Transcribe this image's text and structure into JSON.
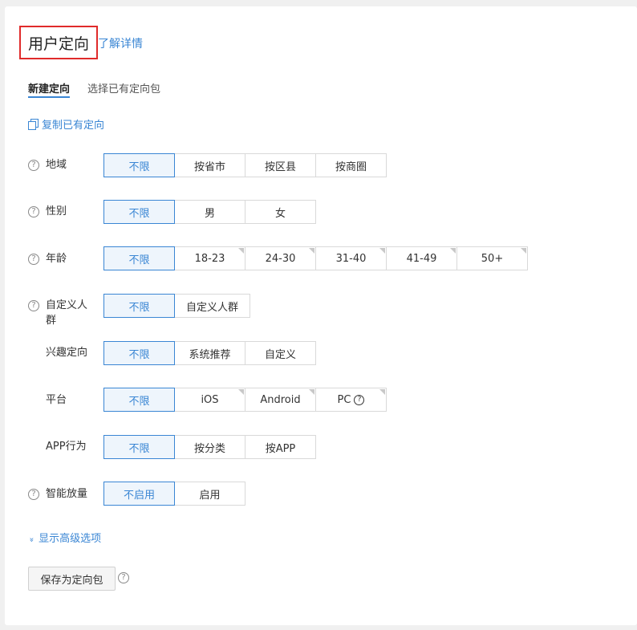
{
  "header": {
    "title": "用户定向",
    "detail_link": "了解详情"
  },
  "tabs": [
    {
      "label": "新建定向",
      "active": true
    },
    {
      "label": "选择已有定向包",
      "active": false
    }
  ],
  "copy_link": "复制已有定向",
  "rows": {
    "region": {
      "label": "地域",
      "options": [
        "不限",
        "按省市",
        "按区县",
        "按商圈"
      ]
    },
    "gender": {
      "label": "性别",
      "options": [
        "不限",
        "男",
        "女"
      ]
    },
    "age": {
      "label": "年龄",
      "options": [
        "不限",
        "18-23",
        "24-30",
        "31-40",
        "41-49",
        "50+"
      ]
    },
    "custom": {
      "label_line1": "自定义人",
      "label_line2": "群",
      "options": [
        "不限",
        "自定义人群"
      ]
    },
    "interest": {
      "label": "兴趣定向",
      "options": [
        "不限",
        "系统推荐",
        "自定义"
      ]
    },
    "platform": {
      "label": "平台",
      "options": [
        "不限",
        "iOS",
        "Android",
        "PC"
      ]
    },
    "app": {
      "label": "APP行为",
      "options": [
        "不限",
        "按分类",
        "按APP"
      ]
    },
    "smart": {
      "label": "智能放量",
      "options": [
        "不启用",
        "启用"
      ]
    }
  },
  "help_glyph": "?",
  "advanced_link": "显示高级选项",
  "advanced_chevron": "»",
  "save_button": "保存为定向包",
  "colors": {
    "accent": "#3a86d4",
    "highlight_border": "#e02b2b"
  }
}
